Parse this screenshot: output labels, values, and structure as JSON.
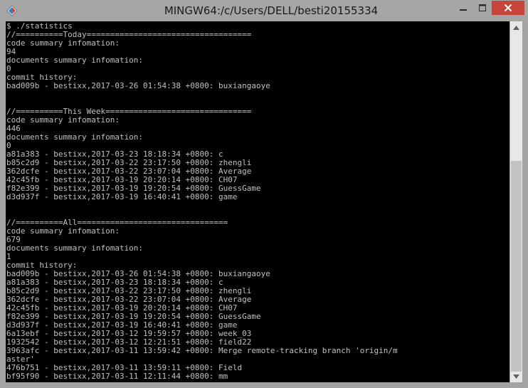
{
  "window": {
    "title": "MINGW64:/c/Users/DELL/besti20155334",
    "minimize_glyph": "—",
    "close_glyph": "✕",
    "app_icon": "mintty-icon"
  },
  "colors": {
    "titlebar": "#a6a6a6",
    "close_button": "#c7443a",
    "terminal_bg": "#000000",
    "terminal_fg": "#c0c0c0"
  },
  "terminal": {
    "lines": [
      "$ ./statistics",
      "//==========Today===================================",
      "code summary infomation:",
      "94",
      "documents summary infomation:",
      "0",
      "commit history:",
      "bad009b - bestixx,2017-03-26 01:54:38 +0800: buxiangaoye",
      "",
      "",
      "//==========This Week===============================",
      "code summary infomation:",
      "446",
      "documents summary infomation:",
      "0",
      "a81a383 - bestixx,2017-03-23 18:18:34 +0800: c",
      "b85c2d9 - bestixx,2017-03-22 23:17:50 +0800: zhengli",
      "362dcfe - bestixx,2017-03-22 23:07:04 +0800: Average",
      "42c45fb - bestixx,2017-03-19 20:20:14 +0800: CH07",
      "f82e399 - bestixx,2017-03-19 19:20:54 +0800: GuessGame",
      "d3d937f - bestixx,2017-03-19 16:40:41 +0800: game",
      "",
      "",
      "//==========All================================",
      "code summary infomation:",
      "679",
      "documents summary infomation:",
      "1",
      "commit history:",
      "bad009b - bestixx,2017-03-26 01:54:38 +0800: buxiangaoye",
      "a81a383 - bestixx,2017-03-23 18:18:34 +0800: c",
      "b85c2d9 - bestixx,2017-03-22 23:17:50 +0800: zhengli",
      "362dcfe - bestixx,2017-03-22 23:07:04 +0800: Average",
      "42c45fb - bestixx,2017-03-19 20:20:14 +0800: CH07",
      "f82e399 - bestixx,2017-03-19 19:20:54 +0800: GuessGame",
      "d3d937f - bestixx,2017-03-19 16:40:41 +0800: game",
      "6a13ebf - bestixx,2017-03-12 19:59:57 +0800: week_03",
      "1932542 - bestixx,2017-03-12 12:21:51 +0800: field22",
      "3963afc - bestixx,2017-03-11 13:59:42 +0800: Merge remote-tracking branch 'origin/m",
      "aster'",
      "476b751 - bestixx,2017-03-11 13:59:11 +0800: Field",
      "bf95f90 - bestixx,2017-03-11 12:11:44 +0800: mm"
    ]
  },
  "scrollbar": {
    "up_icon": "scroll-up-arrow-icon",
    "down_icon": "scroll-down-arrow-icon",
    "position_fraction": 0.43
  }
}
